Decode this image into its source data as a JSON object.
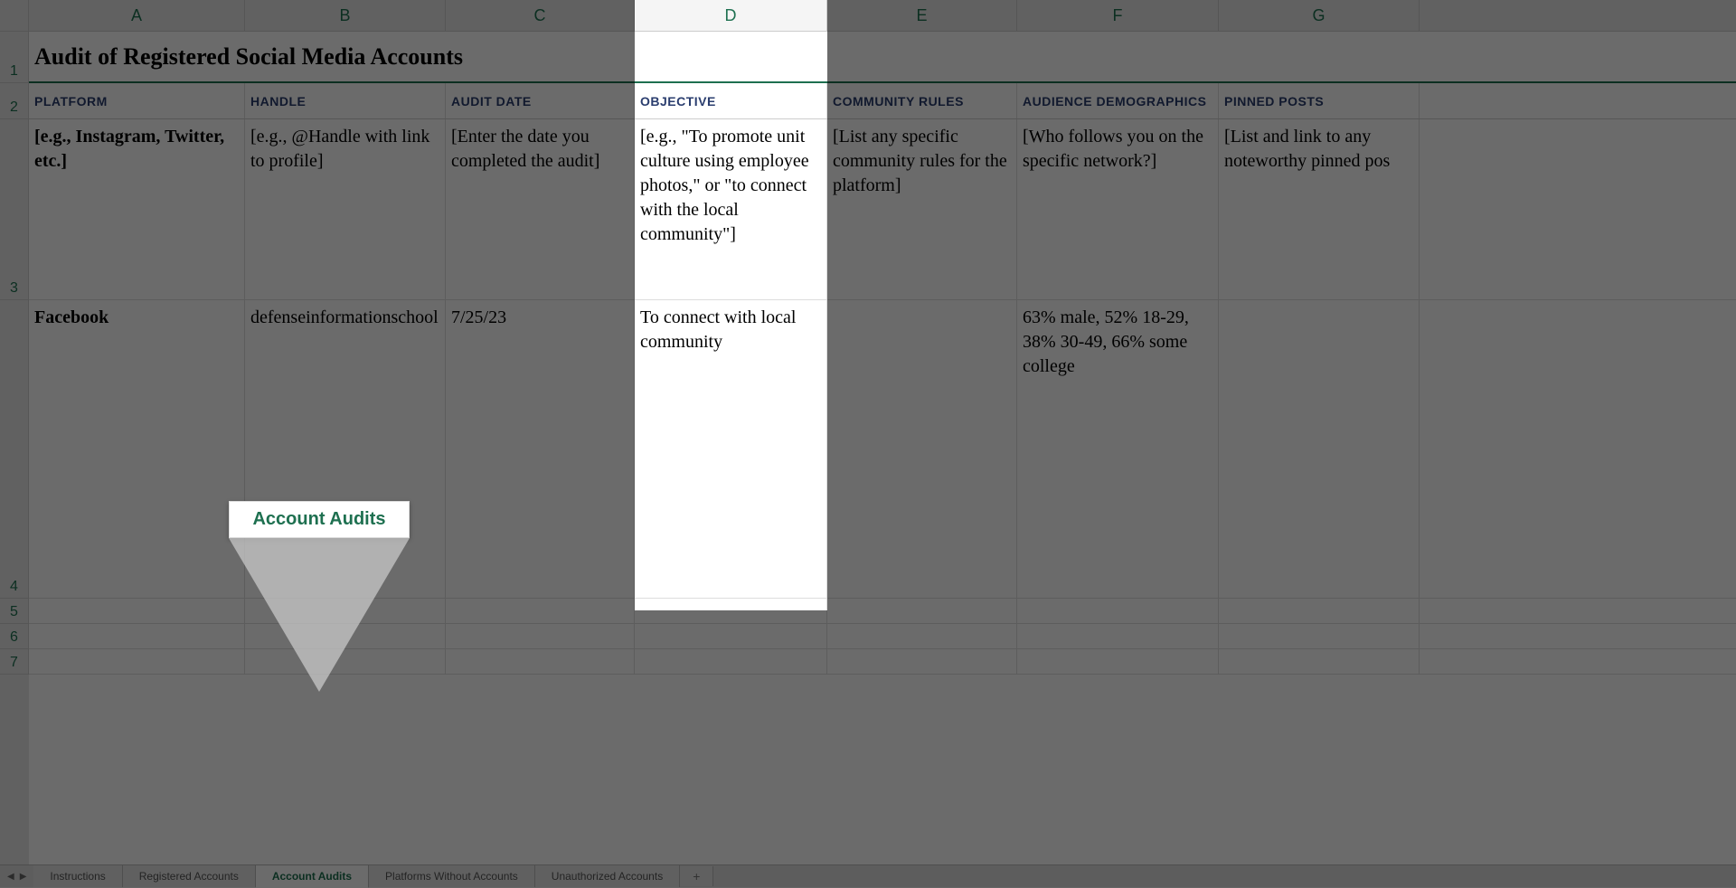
{
  "columns": [
    "A",
    "B",
    "C",
    "D",
    "E",
    "F",
    "G"
  ],
  "rowNumbers": [
    "1",
    "2",
    "3",
    "4",
    "5",
    "6",
    "7"
  ],
  "title": "Audit of Registered Social Media Accounts",
  "headers": {
    "platform": "PLATFORM",
    "handle": "HANDLE",
    "auditDate": "AUDIT DATE",
    "objective": "OBJECTIVE",
    "communityRules": "COMMUNITY RULES",
    "audienceDemographics": "AUDIENCE DEMOGRAPHICS",
    "pinnedPosts": "PINNED POSTS"
  },
  "examples": {
    "platform": "[e.g., Instagram, Twitter, etc.]",
    "handle": "[e.g., @Handle with link to profile]",
    "auditDate": "[Enter the date you completed the audit]",
    "objective": "[e.g., \"To promote unit culture using employee photos,\" or \"to connect with the local community\"]",
    "communityRules": "[List any specific community rules for the platform]",
    "audienceDemographics": "[Who follows you on the specific network?]",
    "pinnedPosts": "[List and link to any noteworthy pinned pos"
  },
  "data": {
    "platform": "Facebook",
    "handle": "defenseinformationschool",
    "auditDate": "7/25/23",
    "objective": "To connect with local community",
    "communityRules": "",
    "audienceDemographics": "63% male, 52% 18-29, 38% 30-49, 66% some college",
    "pinnedPosts": ""
  },
  "callout": {
    "label": "Account Audits"
  },
  "sheetTabs": {
    "nav": {
      "prev": "◀",
      "next": "▶"
    },
    "tabs": [
      {
        "name": "Instructions",
        "active": false
      },
      {
        "name": "Registered Accounts",
        "active": false
      },
      {
        "name": "Account Audits",
        "active": true
      },
      {
        "name": "Platforms Without Accounts",
        "active": false
      },
      {
        "name": "Unauthorized Accounts",
        "active": false
      }
    ],
    "add": "+"
  },
  "rowHeights": {
    "r1": 57,
    "r2": 40,
    "r3": 200,
    "r4": 330,
    "r5": 28,
    "r6": 28,
    "r7": 28
  }
}
